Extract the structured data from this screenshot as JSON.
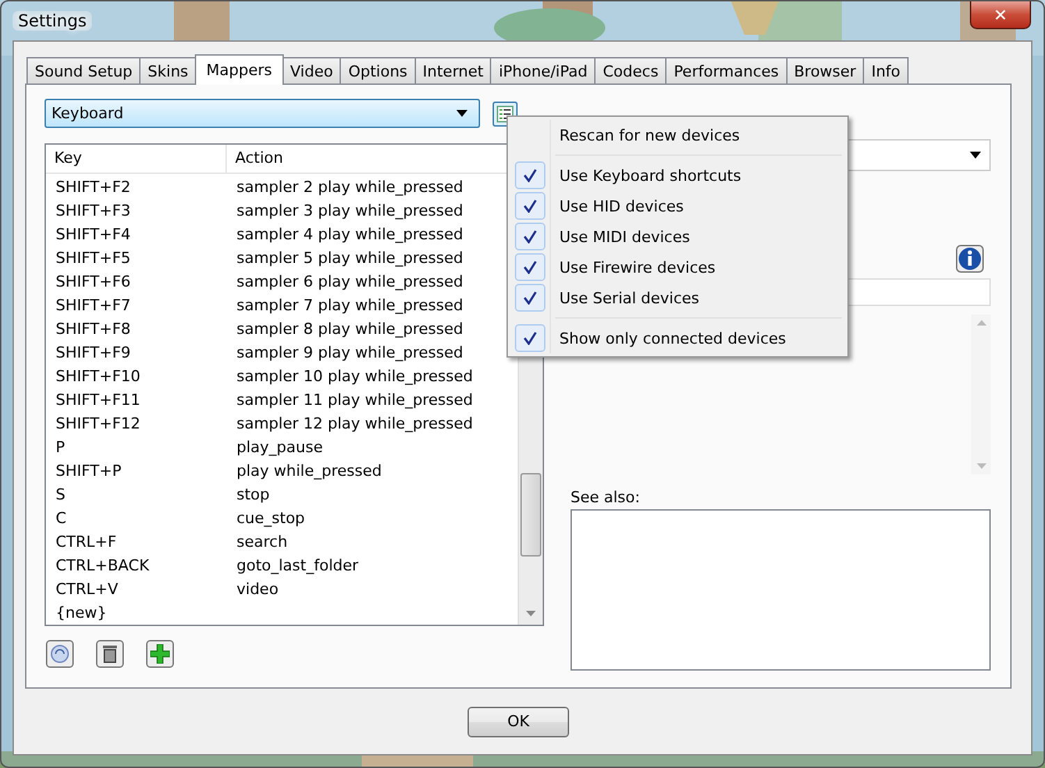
{
  "window": {
    "title": "Settings",
    "close": "✕"
  },
  "tabs": [
    {
      "label": "Sound Setup",
      "selected": false
    },
    {
      "label": "Skins",
      "selected": false
    },
    {
      "label": "Mappers",
      "selected": true
    },
    {
      "label": "Video",
      "selected": false
    },
    {
      "label": "Options",
      "selected": false
    },
    {
      "label": "Internet",
      "selected": false
    },
    {
      "label": "iPhone/iPad",
      "selected": false
    },
    {
      "label": "Codecs",
      "selected": false
    },
    {
      "label": "Performances",
      "selected": false
    },
    {
      "label": "Browser",
      "selected": false
    },
    {
      "label": "Info",
      "selected": false
    }
  ],
  "device_select": {
    "value": "Keyboard"
  },
  "table": {
    "columns": [
      "Key",
      "Action"
    ],
    "rows": [
      [
        "SHIFT+F2",
        "sampler 2 play while_pressed"
      ],
      [
        "SHIFT+F3",
        "sampler 3 play while_pressed"
      ],
      [
        "SHIFT+F4",
        "sampler 4 play while_pressed"
      ],
      [
        "SHIFT+F5",
        "sampler 5 play while_pressed"
      ],
      [
        "SHIFT+F6",
        "sampler 6 play while_pressed"
      ],
      [
        "SHIFT+F7",
        "sampler 7 play while_pressed"
      ],
      [
        "SHIFT+F8",
        "sampler 8 play while_pressed"
      ],
      [
        "SHIFT+F9",
        "sampler 9 play while_pressed"
      ],
      [
        "SHIFT+F10",
        "sampler 10 play while_pressed"
      ],
      [
        "SHIFT+F11",
        "sampler 11 play while_pressed"
      ],
      [
        "SHIFT+F12",
        "sampler 12 play while_pressed"
      ],
      [
        "P",
        "play_pause"
      ],
      [
        "SHIFT+P",
        "play while_pressed"
      ],
      [
        "S",
        "stop"
      ],
      [
        "C",
        "cue_stop"
      ],
      [
        "CTRL+F",
        "search"
      ],
      [
        "CTRL+BACK",
        "goto_last_folder"
      ],
      [
        "CTRL+V",
        "video"
      ],
      [
        "{new}",
        ""
      ]
    ]
  },
  "see_also": {
    "label": "See also:"
  },
  "menu": {
    "items": [
      {
        "kind": "command",
        "label": "Rescan for new devices"
      },
      {
        "kind": "separator"
      },
      {
        "kind": "check",
        "label": "Use Keyboard shortcuts",
        "checked": true
      },
      {
        "kind": "check",
        "label": "Use HID devices",
        "checked": true
      },
      {
        "kind": "check",
        "label": "Use MIDI devices",
        "checked": true
      },
      {
        "kind": "check",
        "label": "Use Firewire devices",
        "checked": true
      },
      {
        "kind": "check",
        "label": "Use Serial devices",
        "checked": true
      },
      {
        "kind": "separator"
      },
      {
        "kind": "check",
        "label": "Show only connected devices",
        "checked": true
      }
    ]
  },
  "buttons": [
    "OK"
  ]
}
